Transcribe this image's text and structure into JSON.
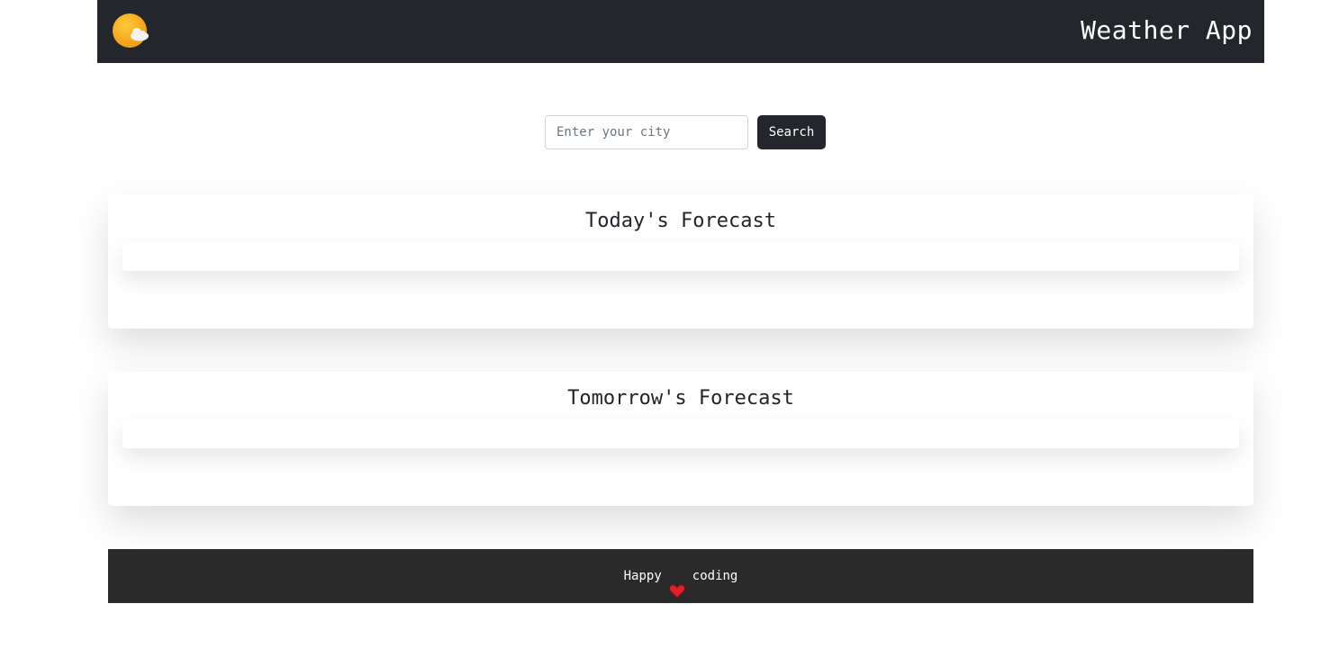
{
  "header": {
    "logo_icon": "sun-cloud-icon",
    "brand": "Weather App"
  },
  "search": {
    "placeholder": "Enter your city",
    "value": "",
    "button_label": "Search"
  },
  "forecasts": [
    {
      "title": "Today's Forecast"
    },
    {
      "title": "Tomorrow's Forecast"
    }
  ],
  "footer": {
    "text_before": "Happy",
    "icon": "heart-icon",
    "text_after": "coding"
  },
  "colors": {
    "navbar": "#23262b",
    "footer": "#2a2a2a",
    "sun": "#f5a623",
    "heart": "#e0202a"
  }
}
